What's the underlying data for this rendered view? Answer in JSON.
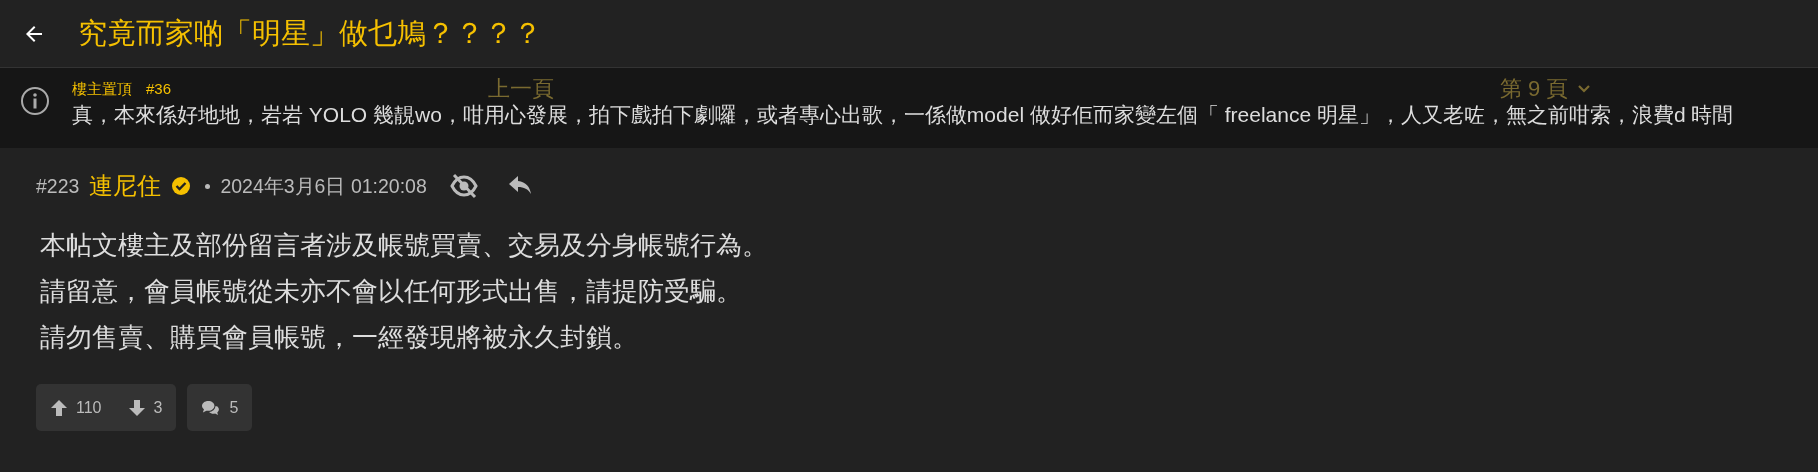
{
  "header": {
    "title": "究竟而家啲「明星」做乜鳩？？？？"
  },
  "pinned": {
    "label": "樓主置頂",
    "number": "#36",
    "text": "真，本來係好地地，岩岩 YOLO 幾靚wo，咁用心發展，拍下戲拍下劇囉，或者專心出歌，一係做model 做好佢而家變左個「 freelance 明星」，人又老咗，無之前咁索，浪費d 時間"
  },
  "pager": {
    "previous": "上一頁",
    "page": "第 9 頁"
  },
  "post": {
    "number": "#223",
    "author": "連尼住",
    "verified": true,
    "time": "2024年3月6日 01:20:08",
    "body": [
      "本帖文樓主及部份留言者涉及帳號買賣、交易及分身帳號行為。",
      "請留意，會員帳號從未亦不會以任何形式出售，請提防受騙。",
      "請勿售賣、購買會員帳號，一經發現將被永久封鎖。"
    ],
    "upvotes": "110",
    "downvotes": "3",
    "replies": "5"
  }
}
